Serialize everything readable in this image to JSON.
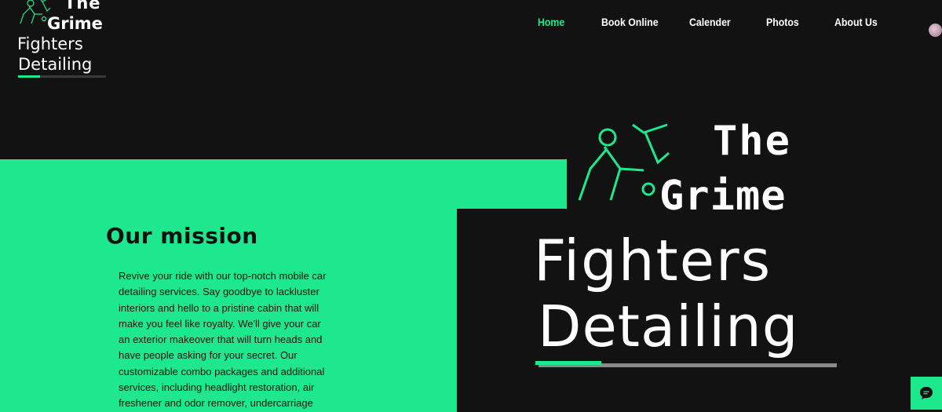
{
  "brand": {
    "line1": "The",
    "line2": "Grime",
    "line3": "Fighters",
    "line4": "Detailing"
  },
  "nav": {
    "items": [
      {
        "label": "Home",
        "active": true
      },
      {
        "label": "Book Online",
        "active": false
      },
      {
        "label": "Calender",
        "active": false
      },
      {
        "label": "Photos",
        "active": false
      },
      {
        "label": "About Us",
        "active": false
      }
    ]
  },
  "mission": {
    "title": "Our mission",
    "text": "Revive your ride with our top-notch mobile car detailing services. Say goodbye to lackluster interiors and hello to a pristine cabin that will make you feel like royalty. We'll give your car an exterior makeover that will turn heads and have people asking for your secret. Our customizable combo packages and additional services, including headlight restoration, air freshener and odor remover, undercarriage"
  },
  "hero_logo": {
    "line1": "The",
    "line2": "Grime",
    "line3": "Fighters",
    "line4": "Detailing"
  },
  "colors": {
    "accent": "#1de88d",
    "background": "#121212",
    "text_light": "#ffffff",
    "text_dark": "#111111"
  },
  "icons": {
    "chat": "chat-bubble-icon",
    "avatar": "user-avatar"
  }
}
